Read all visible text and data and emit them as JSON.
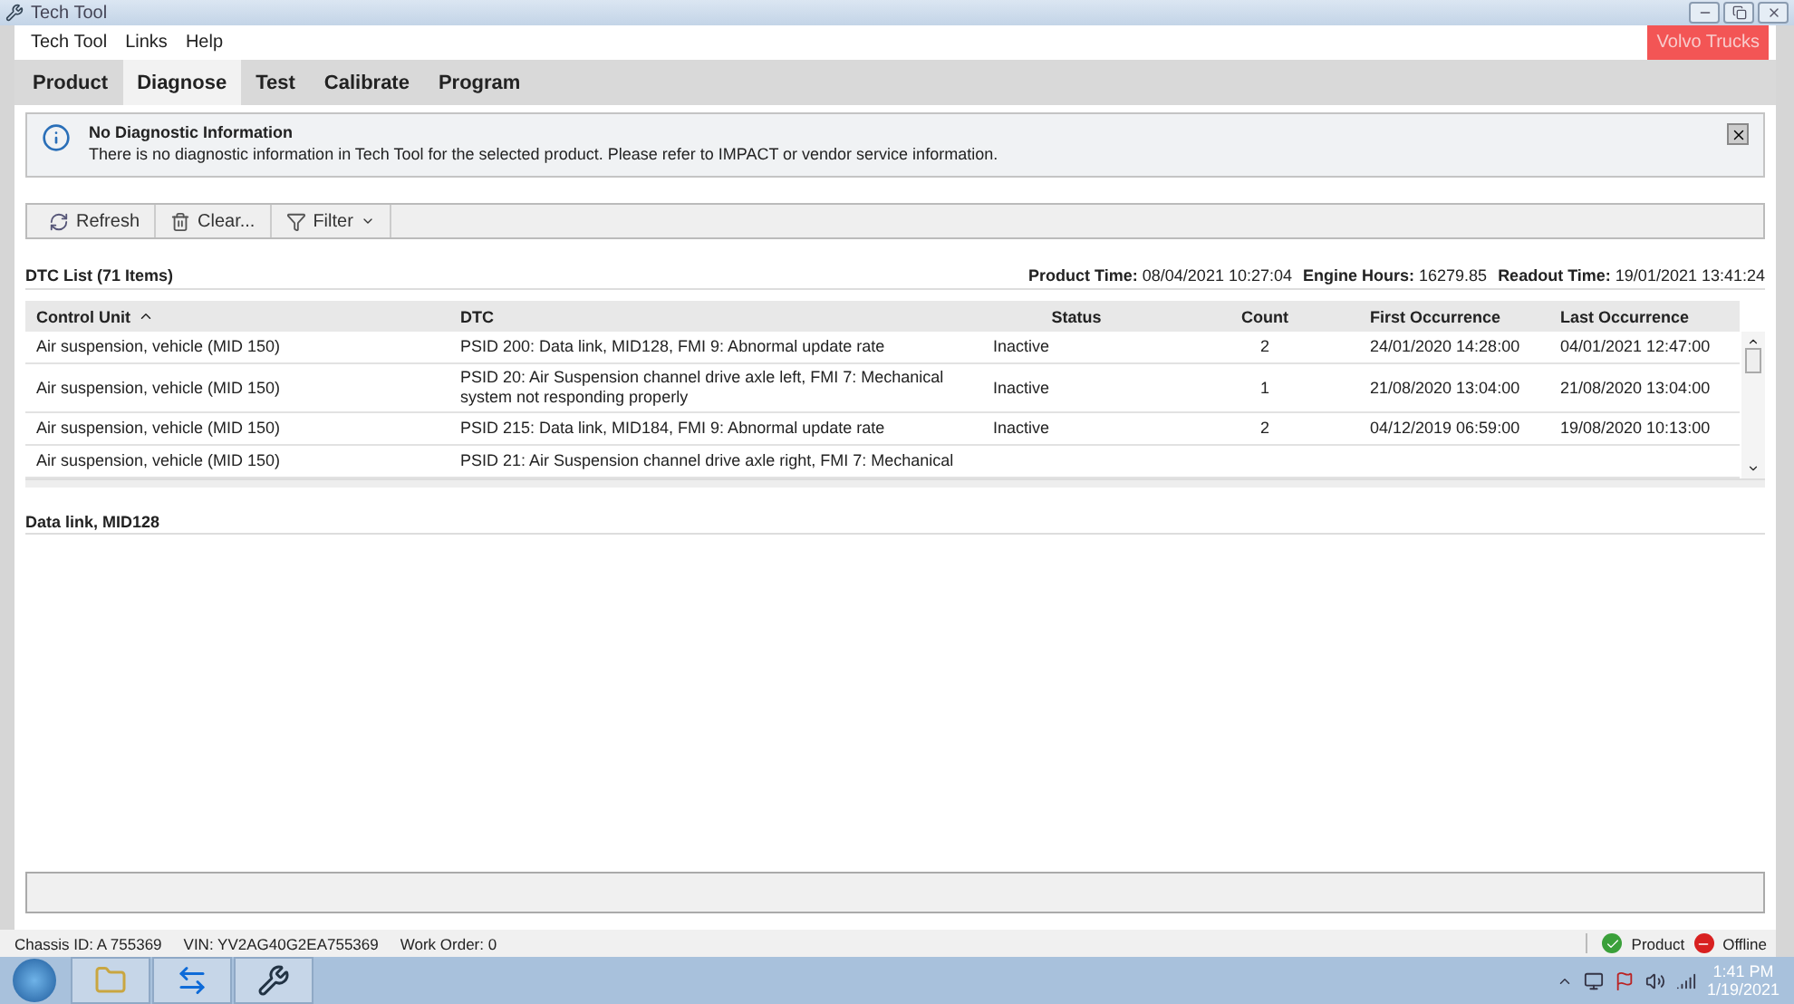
{
  "window": {
    "title": "Tech Tool"
  },
  "menu": [
    "Tech Tool",
    "Links",
    "Help"
  ],
  "brand_badge": "Volvo Trucks",
  "tabs": [
    {
      "label": "Product",
      "selected": false
    },
    {
      "label": "Diagnose",
      "selected": true
    },
    {
      "label": "Test",
      "selected": false
    },
    {
      "label": "Calibrate",
      "selected": false
    },
    {
      "label": "Program",
      "selected": false
    }
  ],
  "info_banner": {
    "title": "No Diagnostic Information",
    "message": "There is no diagnostic information in Tech Tool for the selected product. Please refer to IMPACT or vendor service information."
  },
  "toolbar": [
    {
      "label": "Refresh",
      "kind": "refresh"
    },
    {
      "label": "Clear...",
      "kind": "clear"
    },
    {
      "label": "Filter",
      "kind": "filter"
    }
  ],
  "dtc_list": {
    "title": "DTC List (71 Items)",
    "meta": [
      {
        "label": "Product Time:",
        "value": "08/04/2021 10:27:04"
      },
      {
        "label": "Engine Hours:",
        "value": "16279.85"
      },
      {
        "label": "Readout Time:",
        "value": "19/01/2021 13:41:24"
      }
    ],
    "columns": [
      "Control Unit",
      "DTC",
      "Status",
      "Count",
      "First Occurrence",
      "Last Occurrence"
    ],
    "rows": [
      {
        "control_unit": "Air suspension, vehicle (MID 150)",
        "dtc": "PSID 200: Data link, MID128, FMI 9: Abnormal update rate",
        "status": "Inactive",
        "count": "2",
        "first": "24/01/2020 14:28:00",
        "last": "04/01/2021 12:47:00",
        "selected": false
      },
      {
        "control_unit": "Air suspension, vehicle (MID 150)",
        "dtc": "PSID 20: Air Suspension channel drive axle left, FMI 7: Mechanical system not responding properly",
        "status": "Inactive",
        "count": "1",
        "first": "21/08/2020 13:04:00",
        "last": "21/08/2020 13:04:00",
        "selected": false
      },
      {
        "control_unit": "Air suspension, vehicle (MID 150)",
        "dtc": "PSID 215: Data link, MID184, FMI 9: Abnormal update rate",
        "status": "Inactive",
        "count": "2",
        "first": "04/12/2019 06:59:00",
        "last": "19/08/2020 10:13:00",
        "selected": false
      },
      {
        "control_unit": "Air suspension, vehicle (MID 150)",
        "dtc": "PSID 21: Air Suspension channel drive axle right, FMI 7: Mechanical",
        "selected": false
      }
    ]
  },
  "detail": {
    "title": "Data link, MID128"
  },
  "status_bar": {
    "items": [
      "Chassis ID: A 755369",
      "VIN: YV2AG40G2EA755369",
      "Work Order: 0"
    ],
    "product": "Product",
    "connection": "Offline"
  },
  "taskbar": {
    "time": "1:41 PM",
    "date": "1/19/2021"
  }
}
